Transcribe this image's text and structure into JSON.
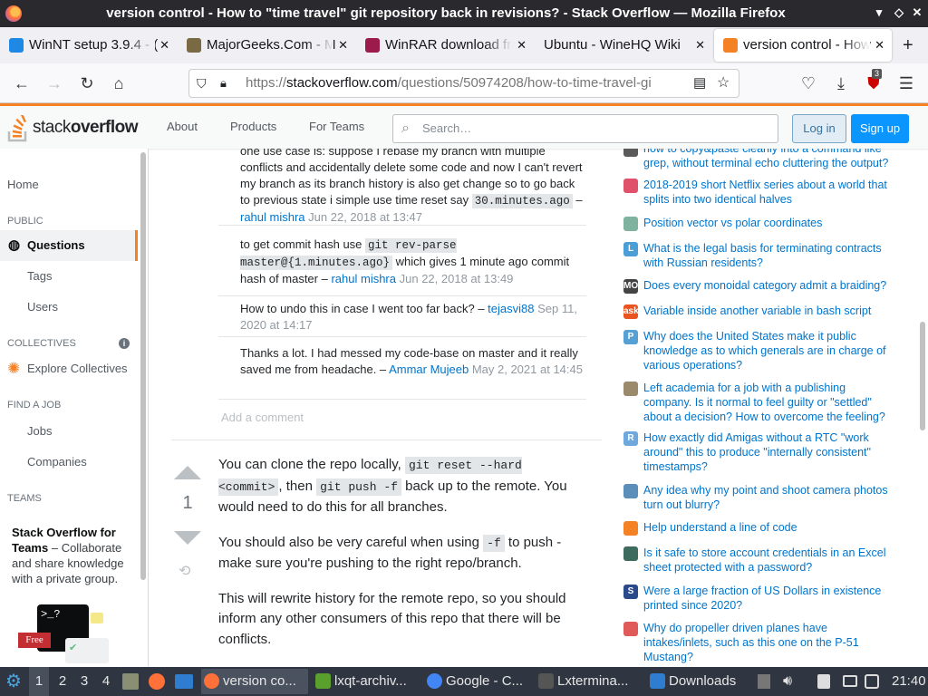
{
  "window": {
    "title": "version control - How to \"time travel\" git repository back in revisions? - Stack Overflow — Mozilla Firefox"
  },
  "tabs": [
    {
      "label": "WinNT setup 3.9.4 - (",
      "fav_color": "#1e88e5"
    },
    {
      "label": "MajorGeeks.Com - M",
      "fav_color": "#7a6a44"
    },
    {
      "label": "WinRAR download fr",
      "fav_color": "#9c1b4c"
    },
    {
      "label": "Ubuntu - WineHQ Wiki",
      "fav_color": "#ffffff"
    },
    {
      "label": "version control - How",
      "fav_color": "#f48225"
    }
  ],
  "url": {
    "prefix": "https://",
    "domain": "stackoverflow.com",
    "path": "/questions/50974208/how-to-time-travel-gi"
  },
  "ext_badge": "3",
  "header": {
    "logo_text_a": "stack",
    "logo_text_b": "overflow",
    "nav": [
      "About",
      "Products",
      "For Teams"
    ],
    "search_placeholder": "Search…",
    "login": "Log in",
    "signup": "Sign up"
  },
  "leftnav": {
    "home": "Home",
    "public": "PUBLIC",
    "questions": "Questions",
    "tags": "Tags",
    "users": "Users",
    "collectives": "COLLECTIVES",
    "explore": "Explore Collectives",
    "find_job": "FIND A JOB",
    "jobs": "Jobs",
    "companies": "Companies",
    "teams": "TEAMS",
    "teams_title": "Stack Overflow for Teams",
    "teams_text": " – Collaborate and share knowledge with a private group.",
    "free": "Free"
  },
  "comments": [
    {
      "pre": "one use case is: suppose I rebase my branch with multiple conflicts and accidentally delete some code and now I can't revert my branch as its branch history is also get change so to go back to previous state i simple use time reset say ",
      "code": "30.minutes.ago",
      "post": "",
      "user": "rahul mishra",
      "date": "Jun 22, 2018 at 13:47"
    },
    {
      "pre": "to get commit hash use ",
      "code": "git rev-parse master@{1.minutes.ago}",
      "post": " which gives 1 minute ago commit hash of master",
      "user": "rahul mishra",
      "date": "Jun 22, 2018 at 13:49"
    },
    {
      "pre": "How to undo this in case I went too far back?",
      "code": "",
      "post": "",
      "user": "tejasvi88",
      "date": "Sep 11, 2020 at 14:17"
    },
    {
      "pre": "Thanks a lot. I had messed my code-base on master and it really saved me from headache.",
      "code": "",
      "post": "",
      "user": "Ammar Mujeeb",
      "date": "May 2, 2021 at 14:45"
    }
  ],
  "add_comment": "Add a comment",
  "answer": {
    "score": "1",
    "p1a": "You can clone the repo locally, ",
    "p1code1": "git reset --hard <commit>",
    "p1b": ", then ",
    "p1code2": "git push -f",
    "p1c": " back up to the remote. You would need to do this for all branches.",
    "p2a": "You should also be very careful when using ",
    "p2code": "-f",
    "p2b": " to push - make sure you're pushing to the right repo/branch.",
    "p3": "This will rewrite history for the remote repo, so you should inform any other consumers of this repo that there will be conflicts."
  },
  "hot": [
    {
      "text": "how to copy&paste cleanly into a command like grep, without terminal echo cluttering the output?",
      "icon": "",
      "color": "#5a5a5a"
    },
    {
      "text": "2018-2019 short Netflix series about a world that splits into two identical halves",
      "icon": "",
      "color": "#e0526a"
    },
    {
      "text": "Position vector vs polar coordinates",
      "icon": "",
      "color": "#7fb3a0"
    },
    {
      "text": "What is the legal basis for terminating contracts with Russian residents?",
      "icon": "L",
      "color": "#4c9fd6"
    },
    {
      "text": "Does every monoidal category admit a braiding?",
      "icon": "MO",
      "color": "#444444"
    },
    {
      "text": "Variable inside another variable in bash script",
      "icon": "ask",
      "color": "#e95420"
    },
    {
      "text": "Why does the United States make it public knowledge as to which generals are in charge of various operations?",
      "icon": "P",
      "color": "#56a0d3"
    },
    {
      "text": "Left academia for a job with a publishing company. Is it normal to feel guilty or \"settled\" about a decision? How to overcome the feeling?",
      "icon": "",
      "color": "#9b8a6b"
    },
    {
      "text": "How exactly did Amigas without a RTC \"work around\" this to produce \"internally consistent\" timestamps?",
      "icon": "R",
      "color": "#6fa8dc"
    },
    {
      "text": "Any idea why my point and shoot camera photos turn out blurry?",
      "icon": "",
      "color": "#5b8fb9"
    },
    {
      "text": "Help understand a line of code",
      "icon": "",
      "color": "#f48225"
    },
    {
      "text": "Is it safe to store account credentials in an Excel sheet protected with a password?",
      "icon": "",
      "color": "#3d6b5e"
    },
    {
      "text": "Were a large fraction of US Dollars in existence printed since 2020?",
      "icon": "S",
      "color": "#2b4a8c"
    },
    {
      "text": "Why do propeller driven planes have intakes/inlets, such as this one on the P-51 Mustang?",
      "icon": "",
      "color": "#e05a5a"
    }
  ],
  "taskbar": {
    "workspaces": [
      "1",
      "2",
      "3",
      "4"
    ],
    "windows": [
      {
        "label": "version co...",
        "color": "#ff7139"
      },
      {
        "label": "lxqt-archiv...",
        "color": "#5aa02c"
      },
      {
        "label": "Google - C...",
        "color": "#4285f4"
      },
      {
        "label": "Lxtermina...",
        "color": "#555555"
      },
      {
        "label": "Downloads",
        "color": "#2f7dd1"
      }
    ],
    "clock": "21:40"
  }
}
